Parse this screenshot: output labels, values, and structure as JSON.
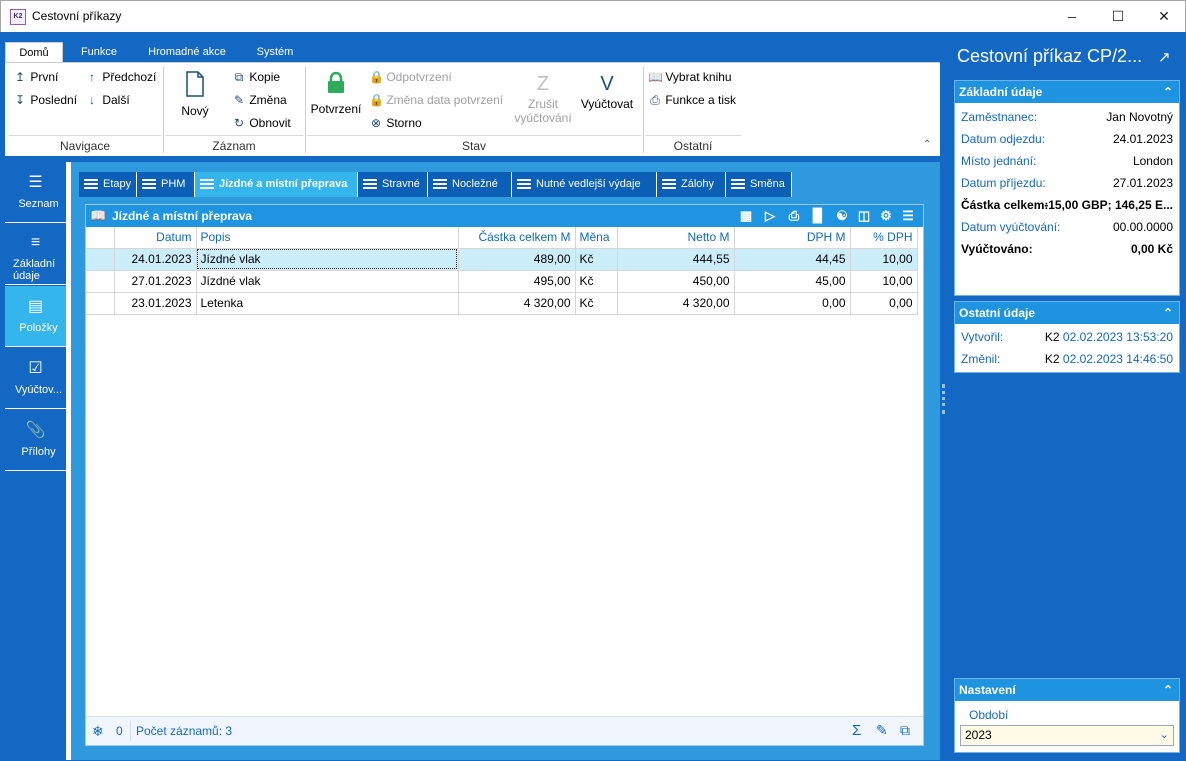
{
  "window": {
    "title": "Cestovní příkazy",
    "logo_text": "K2"
  },
  "ribbon": {
    "tabs": [
      "Domů",
      "Funkce",
      "Hromadné akce",
      "Systém"
    ],
    "nav": {
      "first": "První",
      "last": "Poslední",
      "prev": "Předchozí",
      "next": "Další",
      "group": "Navigace"
    },
    "record": {
      "new": "Nový",
      "copy": "Kopie",
      "change": "Změna",
      "refresh": "Obnovit",
      "group": "Záznam"
    },
    "state": {
      "confirm": "Potvrzení",
      "unconfirm": "Odpotvrzení",
      "change_date": "Změna data potvrzení",
      "cancel": "Storno",
      "cancel_settlement_1": "Zrušit",
      "cancel_settlement_2": "vyúčtování",
      "settle": "Vyúčtovat",
      "group": "Stav"
    },
    "other": {
      "select_book": "Vybrat knihu",
      "func_print": "Funkce a tisk",
      "group": "Ostatní"
    }
  },
  "sidenav": {
    "items": [
      {
        "label": "Seznam"
      },
      {
        "label": "Základní údaje"
      },
      {
        "label": "Položky"
      },
      {
        "label": "Vyúčtov..."
      },
      {
        "label": "Přílohy"
      }
    ]
  },
  "content_tabs": [
    "Etapy",
    "PHM",
    "Jízdné a místní přeprava",
    "Stravné",
    "Nocležné",
    "Nutné vedlejší výdaje",
    "Zálohy",
    "Směna"
  ],
  "grid": {
    "title": "Jízdné a místní přeprava",
    "columns": [
      "Datum",
      "Popis",
      "Částka celkem M",
      "Měna",
      "Netto M",
      "DPH M",
      "% DPH"
    ],
    "rows": [
      [
        "24.01.2023",
        "Jízdné vlak",
        "489,00",
        "Kč",
        "444,55",
        "44,45",
        "10,00"
      ],
      [
        "27.01.2023",
        "Jízdné vlak",
        "495,00",
        "Kč",
        "450,00",
        "45,00",
        "10,00"
      ],
      [
        "23.01.2023",
        "Letenka",
        "4 320,00",
        "Kč",
        "4 320,00",
        "0,00",
        "0,00"
      ]
    ],
    "footer": {
      "count_value": "0",
      "records_label": "Počet záznamů: 3"
    }
  },
  "right": {
    "title": "Cestovní příkaz CP/2...",
    "basic": {
      "header": "Základní údaje",
      "fields": [
        {
          "label": "Zaměstnanec:",
          "value": "Jan Novotný",
          "bold": false
        },
        {
          "label": "Datum odjezdu:",
          "value": "24.01.2023",
          "bold": false
        },
        {
          "label": "Místo jednání:",
          "value": "London",
          "bold": false
        },
        {
          "label": "Datum příjezdu:",
          "value": "27.01.2023",
          "bold": false
        },
        {
          "label": "Částka celkem:",
          "value": "-15,00 GBP; 146,25 E...",
          "bold": true
        },
        {
          "label": "Datum vyúčtování:",
          "value": "00.00.0000",
          "bold": false
        },
        {
          "label": "Vyúčtováno:",
          "value": "0,00 Kč",
          "bold": true
        }
      ]
    },
    "other": {
      "header": "Ostatní údaje",
      "created_label": "Vytvořil:",
      "created_user": "K2",
      "created_date": "02.02.2023 13:53:20",
      "changed_label": "Změnil:",
      "changed_user": "K2",
      "changed_date": "02.02.2023 14:46:50"
    },
    "settings": {
      "header": "Nastavení",
      "period_label": "Období",
      "period_value": "2023"
    }
  }
}
